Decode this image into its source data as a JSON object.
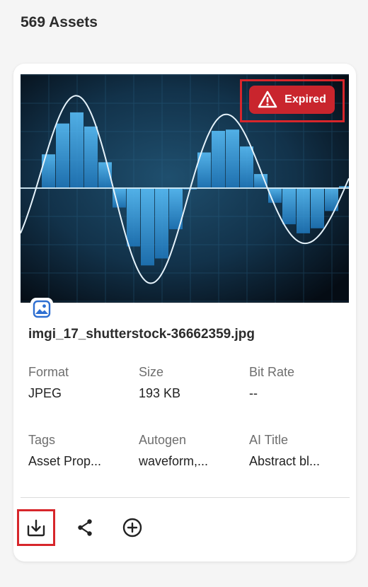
{
  "header": {
    "title": "569 Assets"
  },
  "card": {
    "badge": {
      "label": "Expired",
      "icon": "alert-triangle-icon",
      "color": "#c9252d"
    },
    "type_icon": "image-icon",
    "filename": "imgi_17_shutterstock-36662359.jpg",
    "metadata": [
      {
        "label": "Format",
        "value": "JPEG"
      },
      {
        "label": "Size",
        "value": "193 KB"
      },
      {
        "label": "Bit Rate",
        "value": "--"
      },
      {
        "label": "Tags",
        "value": "Asset Prop..."
      },
      {
        "label": "Autogen",
        "value": "waveform,..."
      },
      {
        "label": "AI Title",
        "value": "Abstract bl..."
      }
    ],
    "actions": [
      {
        "name": "download",
        "icon": "download-icon",
        "selected": true
      },
      {
        "name": "share",
        "icon": "share-icon",
        "selected": false
      },
      {
        "name": "add",
        "icon": "add-circle-icon",
        "selected": false
      }
    ]
  },
  "colors": {
    "accent_red": "#d7262b",
    "badge_red": "#c9252d",
    "image_blue": "#3aa6e8"
  }
}
